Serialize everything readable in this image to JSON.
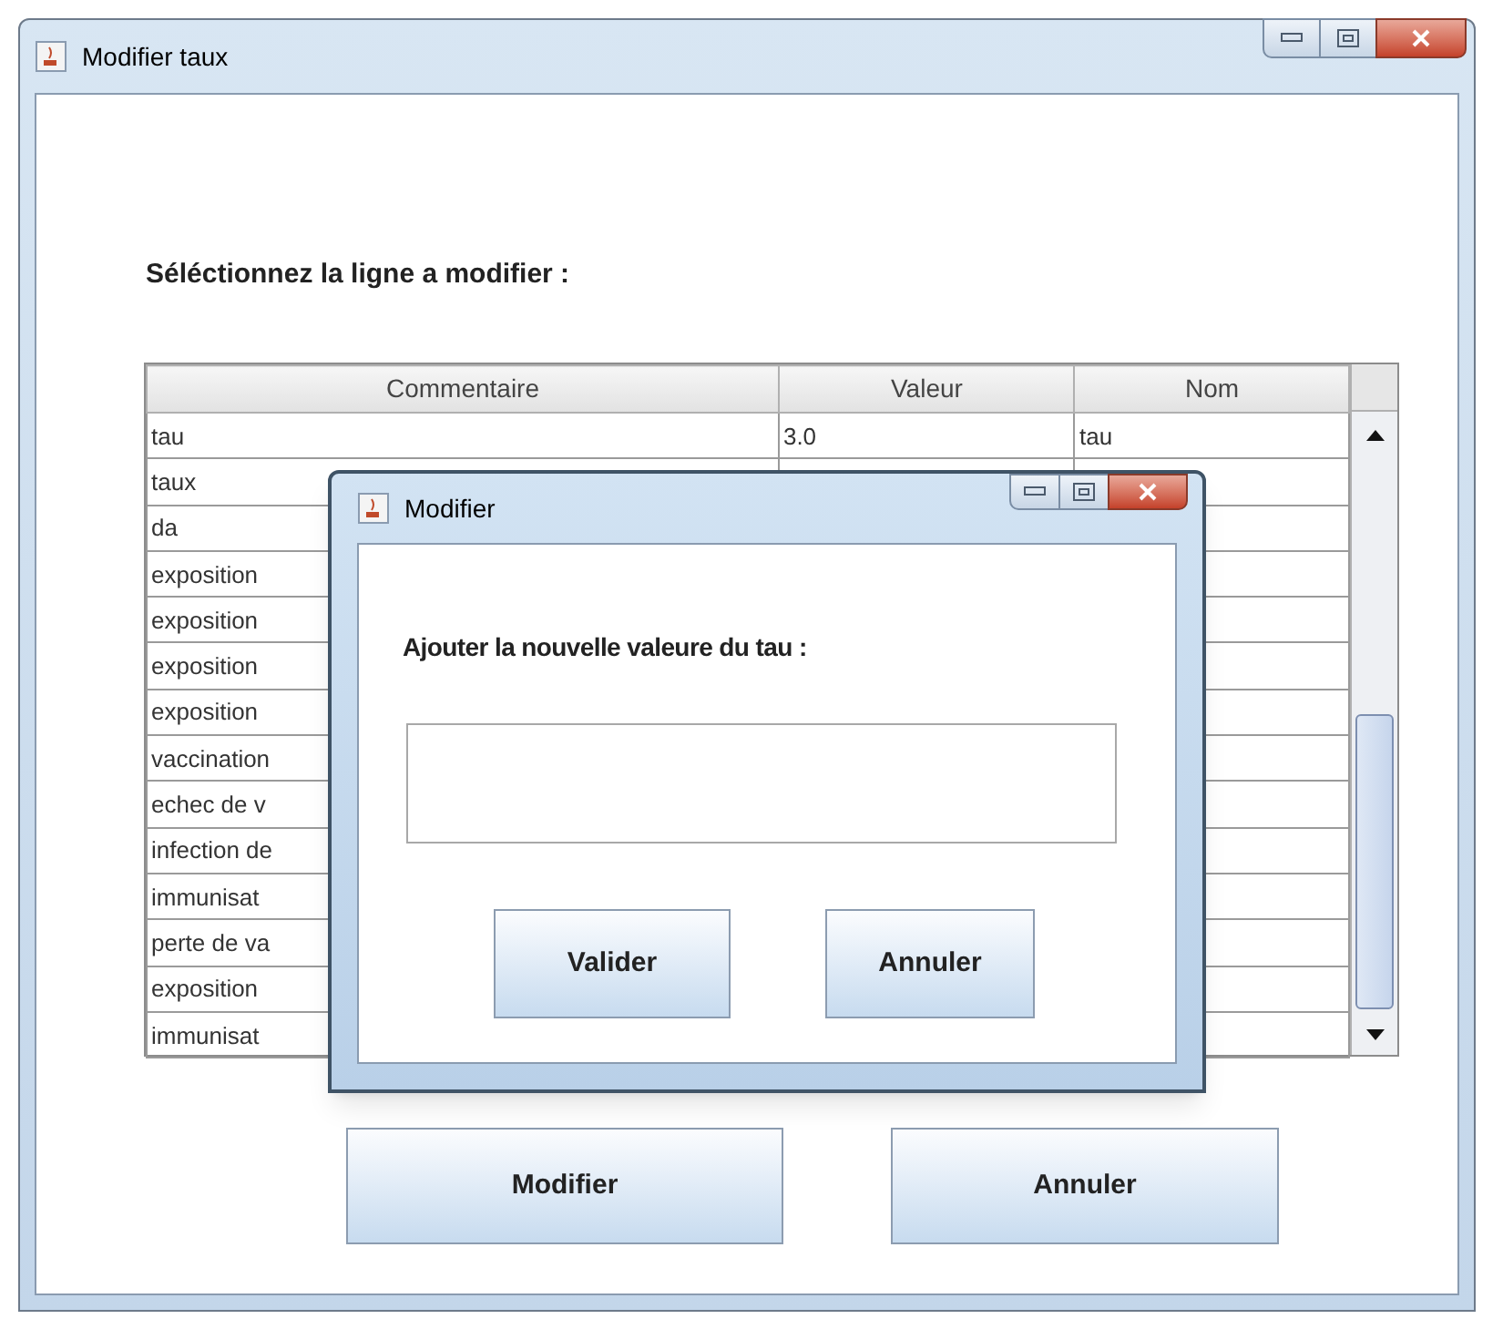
{
  "window": {
    "title": "Modifier taux"
  },
  "heading": "Séléctionnez la ligne a modifier :",
  "table": {
    "columns": [
      "Commentaire",
      "Valeur",
      "Nom"
    ],
    "rows": [
      [
        "tau",
        "3.0",
        "tau"
      ],
      [
        "taux",
        "",
        ""
      ],
      [
        "da",
        "",
        ""
      ],
      [
        "exposition",
        "",
        ""
      ],
      [
        "exposition",
        "",
        ""
      ],
      [
        "exposition",
        "",
        ""
      ],
      [
        "exposition",
        "",
        ""
      ],
      [
        "vaccination",
        "",
        ""
      ],
      [
        "echec de v",
        "",
        ""
      ],
      [
        "infection de",
        "",
        ""
      ],
      [
        "immunisat",
        "",
        ""
      ],
      [
        "perte de va",
        "",
        ""
      ],
      [
        "exposition",
        "",
        ""
      ],
      [
        "immunisat",
        "",
        ""
      ]
    ]
  },
  "buttons": [
    "Modifier",
    "Annuler"
  ],
  "dialog": {
    "title": "Modifier",
    "label": "Ajouter la nouvelle valeure du tau :",
    "buttons": [
      "Valider",
      "Annuler"
    ]
  }
}
